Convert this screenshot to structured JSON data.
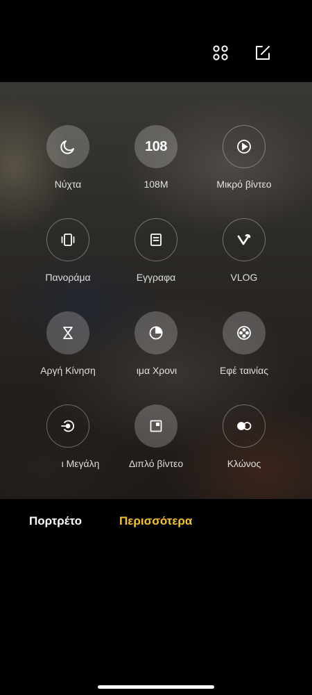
{
  "top_bar": {
    "icons": [
      "grid-icon",
      "edit-icon"
    ]
  },
  "modes": [
    {
      "label": "Νύχτα",
      "icon": "moon-icon",
      "style": "filled"
    },
    {
      "label": "108M",
      "icon": "text-108",
      "glyph": "108",
      "style": "filled"
    },
    {
      "label": "Μικρό βίντεο",
      "icon": "play-icon",
      "style": "outline"
    },
    {
      "label": "Πανοράμα",
      "icon": "panorama-icon",
      "style": "outline"
    },
    {
      "label": "Εγγραφα",
      "icon": "document-icon",
      "style": "outline"
    },
    {
      "label": "VLOG",
      "icon": "vlog-icon",
      "style": "outline"
    },
    {
      "label": "Αργή Κίνηση",
      "icon": "hourglass-icon",
      "style": "filled"
    },
    {
      "label": "ιμα    Χρονι",
      "icon": "timer-icon",
      "style": "filled"
    },
    {
      "label": "Εφέ ταινίας",
      "icon": "film-reel-icon",
      "style": "filled"
    },
    {
      "label": "ι      Μεγάλη",
      "icon": "long-exposure-icon",
      "style": "outline"
    },
    {
      "label": "Διπλό βίντεο",
      "icon": "dual-video-icon",
      "style": "filled"
    },
    {
      "label": "Κλώνος",
      "icon": "clone-icon",
      "style": "outline"
    }
  ],
  "mode_bar": {
    "tabs": [
      {
        "label": "Πορτρέτο",
        "active": false
      },
      {
        "label": "Περισσότερα",
        "active": true
      }
    ],
    "active_color": "#f5c226"
  }
}
